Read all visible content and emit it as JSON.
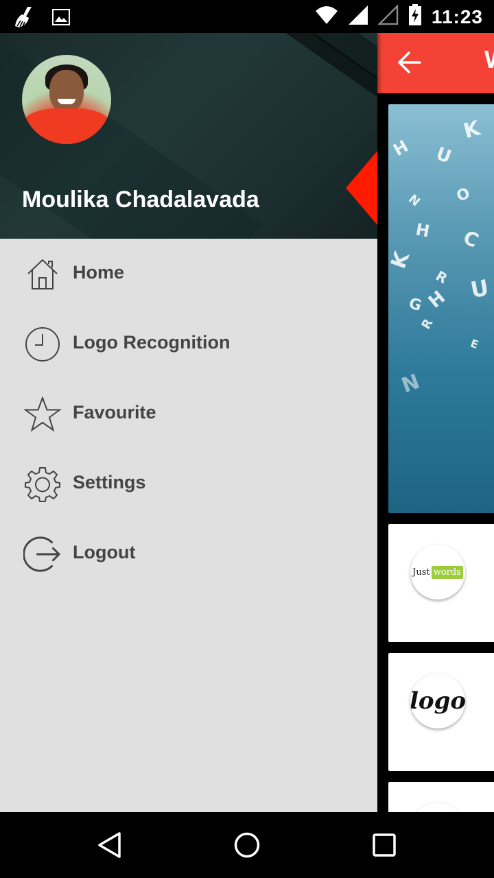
{
  "status_bar": {
    "left_icons": [
      "broom-icon",
      "image-icon"
    ],
    "right_icons": [
      "wifi-icon",
      "signal-icon",
      "signal-empty-icon",
      "battery-charging-icon"
    ],
    "time": "11:23"
  },
  "drawer": {
    "header": {
      "user_name": "Moulika Chadalavada",
      "avatar": "profile-photo"
    },
    "items": [
      {
        "label": "Home",
        "icon": "home-icon"
      },
      {
        "label": "Logo Recognition",
        "icon": "clock-icon"
      },
      {
        "label": "Favourite",
        "icon": "star-icon"
      },
      {
        "label": "Settings",
        "icon": "gear-icon"
      },
      {
        "label": "Logout",
        "icon": "logout-icon"
      }
    ]
  },
  "background_app": {
    "toolbar": {
      "title": "W",
      "back_icon": "arrow-left-icon",
      "color": "#f44336"
    },
    "cards": [
      {
        "logo_text_1": "Just",
        "logo_text_2": "words"
      },
      {
        "logo_text": "logo"
      },
      {}
    ]
  },
  "nav_bar": {
    "buttons": [
      "back-triangle-icon",
      "home-circle-icon",
      "recents-square-icon"
    ]
  },
  "colors": {
    "accent": "#f44336",
    "drawer_bg": "#e0e0e0",
    "menu_text": "#444444"
  }
}
